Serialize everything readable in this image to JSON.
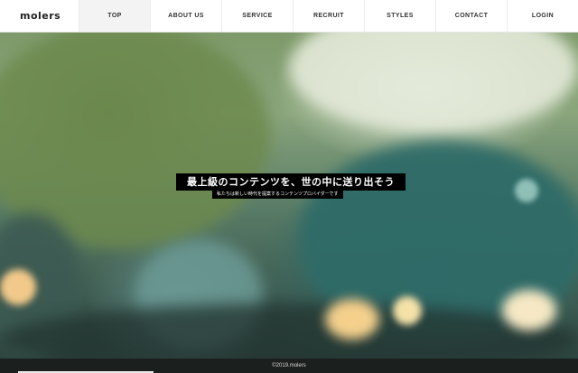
{
  "brand": {
    "logo": "molers"
  },
  "nav": {
    "items": [
      {
        "label": "TOP"
      },
      {
        "label": "ABOUT US"
      },
      {
        "label": "SERVICE"
      },
      {
        "label": "RECRUIT"
      },
      {
        "label": "STYLES"
      },
      {
        "label": "CONTACT"
      },
      {
        "label": "LOGIN"
      }
    ]
  },
  "hero": {
    "title": "最上級のコンテンツを、世の中に送り出そう",
    "subtitle": "私たちは新しい時代を提案するコンテンツプロバイダーです"
  },
  "footer": {
    "copyright": "©2019.molers"
  },
  "colors": {
    "header_bg": "#ffffff",
    "active_nav_bg": "#f3f3f3",
    "caption_bg": "#000000",
    "footer_bg": "#1b1f1e"
  }
}
